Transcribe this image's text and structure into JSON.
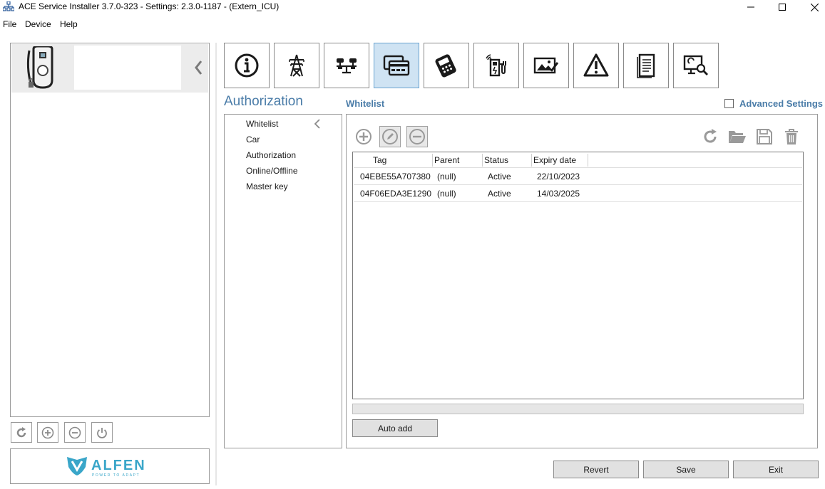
{
  "window": {
    "title": "ACE Service Installer 3.7.0-323 - Settings: 2.3.0-1187 -  (Extern_ICU)",
    "controls": [
      "minimize-icon",
      "maximize-icon",
      "close-icon"
    ]
  },
  "menu": {
    "items": [
      "File",
      "Device",
      "Help"
    ]
  },
  "left_panel": {
    "device_icon": "ev-charger-icon",
    "collapse_icon": "chevron-left-icon",
    "buttons": [
      "refresh-icon",
      "add-circle-icon",
      "remove-circle-icon",
      "power-icon"
    ],
    "logo": {
      "name": "ALFEN",
      "tagline": "POWER TO ADAPT",
      "color": "#3aa6c9"
    }
  },
  "toolbar": {
    "buttons": [
      {
        "icon": "info-icon"
      },
      {
        "icon": "power-tower-icon"
      },
      {
        "icon": "balance-icon"
      },
      {
        "icon": "card-reader-icon",
        "active": true
      },
      {
        "icon": "payment-terminal-icon"
      },
      {
        "icon": "charging-station-wifi-icon"
      },
      {
        "icon": "image-edit-icon"
      },
      {
        "icon": "warning-icon"
      },
      {
        "icon": "document-icon"
      },
      {
        "icon": "monitor-search-icon"
      }
    ]
  },
  "section": {
    "title": "Authorization",
    "subtitle": "Whitelist",
    "advanced_settings_label": "Advanced Settings",
    "advanced_settings_checked": false
  },
  "nav": {
    "items": [
      "Whitelist",
      "Car",
      "Authorization",
      "Online/Offline",
      "Master key"
    ]
  },
  "whitelist": {
    "actions_left": [
      "add-circle-icon",
      "edit-circle-icon",
      "remove-circle-icon"
    ],
    "actions_right": [
      "refresh-icon",
      "folder-open-icon",
      "save-icon",
      "trash-icon"
    ],
    "columns": [
      "Tag",
      "Parent",
      "Status",
      "Expiry date"
    ],
    "rows": [
      {
        "tag": "04EBE55A707380",
        "parent": "(null)",
        "status": "Active",
        "expiry": "22/10/2023"
      },
      {
        "tag": "04F06EDA3E1290",
        "parent": "(null)",
        "status": "Active",
        "expiry": "14/03/2025"
      }
    ],
    "auto_add_label": "Auto add"
  },
  "footer": {
    "revert_label": "Revert",
    "save_label": "Save",
    "exit_label": "Exit"
  },
  "colors": {
    "accent": "#4a7ca8",
    "active_tool": "#cfe3f3",
    "button_face": "#e1e1e1"
  }
}
